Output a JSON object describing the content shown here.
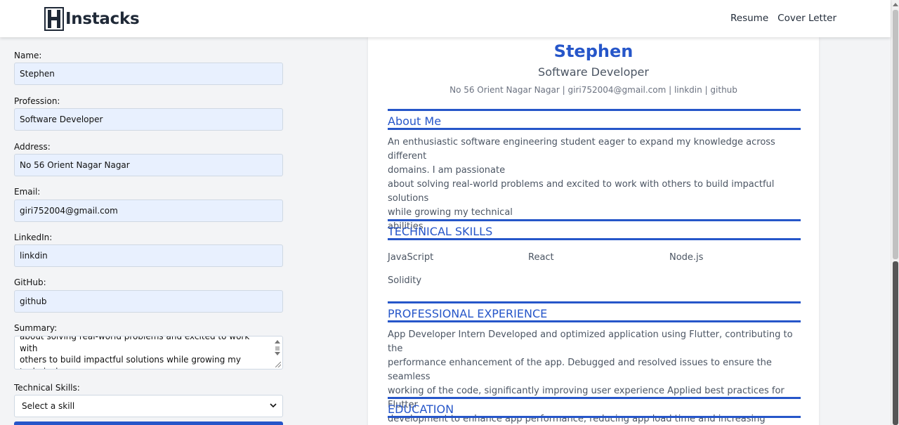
{
  "brand": {
    "name": "Instacks"
  },
  "nav": {
    "links": [
      "Resume",
      "Cover Letter"
    ]
  },
  "form": {
    "name_label": "Name:",
    "name_value": "Stephen",
    "profession_label": "Profession:",
    "profession_value": "Software Developer",
    "address_label": "Address:",
    "address_value": "No 56 Orient Nagar Nagar",
    "email_label": "Email:",
    "email_value": "giri752004@gmail.com",
    "linkedin_label": "LinkedIn:",
    "linkedin_value": "linkdin",
    "github_label": "GitHub:",
    "github_value": "github",
    "summary_label": "Summary:",
    "summary_value": "about solving real-world problems and excited to work with\nothers to build impactful solutions while growing my technical\n abilities.",
    "skills_label": "Technical Skills:",
    "skills_select_value": "Select a skill"
  },
  "resume": {
    "name": "Stephen",
    "profession": "Software Developer",
    "contact": "No 56 Orient Nagar Nagar | giri752004@gmail.com | linkdin | github",
    "about_title": "About Me",
    "about_text": "An enthusiastic software engineering student eager to expand my knowledge across different\ndomains. I am passionate\nabout solving real-world problems and excited to work with others to build impactful solutions\nwhile growing my technical\n abilities.",
    "skills_title": "TECHNICAL SKILLS",
    "skills": [
      "JavaScript",
      "React",
      "Node.js",
      "Solidity"
    ],
    "experience_title": "PROFESSIONAL EXPERIENCE",
    "experience_text": "App Developer Intern Developed and optimized application using Flutter, contributing to the\nperformance enhancement of the app. Debugged and resolved issues to ensure the seamless\nworking of the code, significantly improving user experience Applied best practices for Flutter\ndevelopment to enhance app performance, reducing app load time and increasing responsiveness.",
    "education_title": "EDUCATION"
  },
  "colors": {
    "accent": "#2656c9",
    "field_bg": "#e8f0fe",
    "page_bg": "#f3f4f6"
  }
}
